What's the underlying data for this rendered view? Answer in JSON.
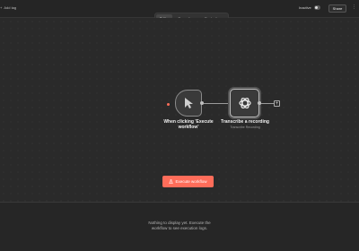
{
  "header": {
    "add_tag_label": "Add tag",
    "inactive_label": "Inactive",
    "share_label": "Share",
    "more_icon": "more-dots-icon"
  },
  "tabs": [
    {
      "label": "Editor",
      "active": true
    },
    {
      "label": "Executions",
      "active": false
    },
    {
      "label": "Evaluations",
      "active": false
    }
  ],
  "nodes": {
    "trigger": {
      "label_line1": "When clicking 'Execute",
      "label_line2": "workflow'",
      "icon": "cursor-icon"
    },
    "transcribe": {
      "label": "Transcribe a recording",
      "sublabel": "Transcribe Recording",
      "icon": "openai-icon"
    }
  },
  "execute_button": {
    "label": "Execute workflow",
    "icon": "flask-icon",
    "color": "#ff6d5a"
  },
  "bottom_panel": {
    "line1": "Nothing to display yet. Execute the",
    "line2": "workflow to see execution logs."
  },
  "colors": {
    "accent": "#ff6d5a",
    "canvas_bg": "#2a2a2a"
  }
}
